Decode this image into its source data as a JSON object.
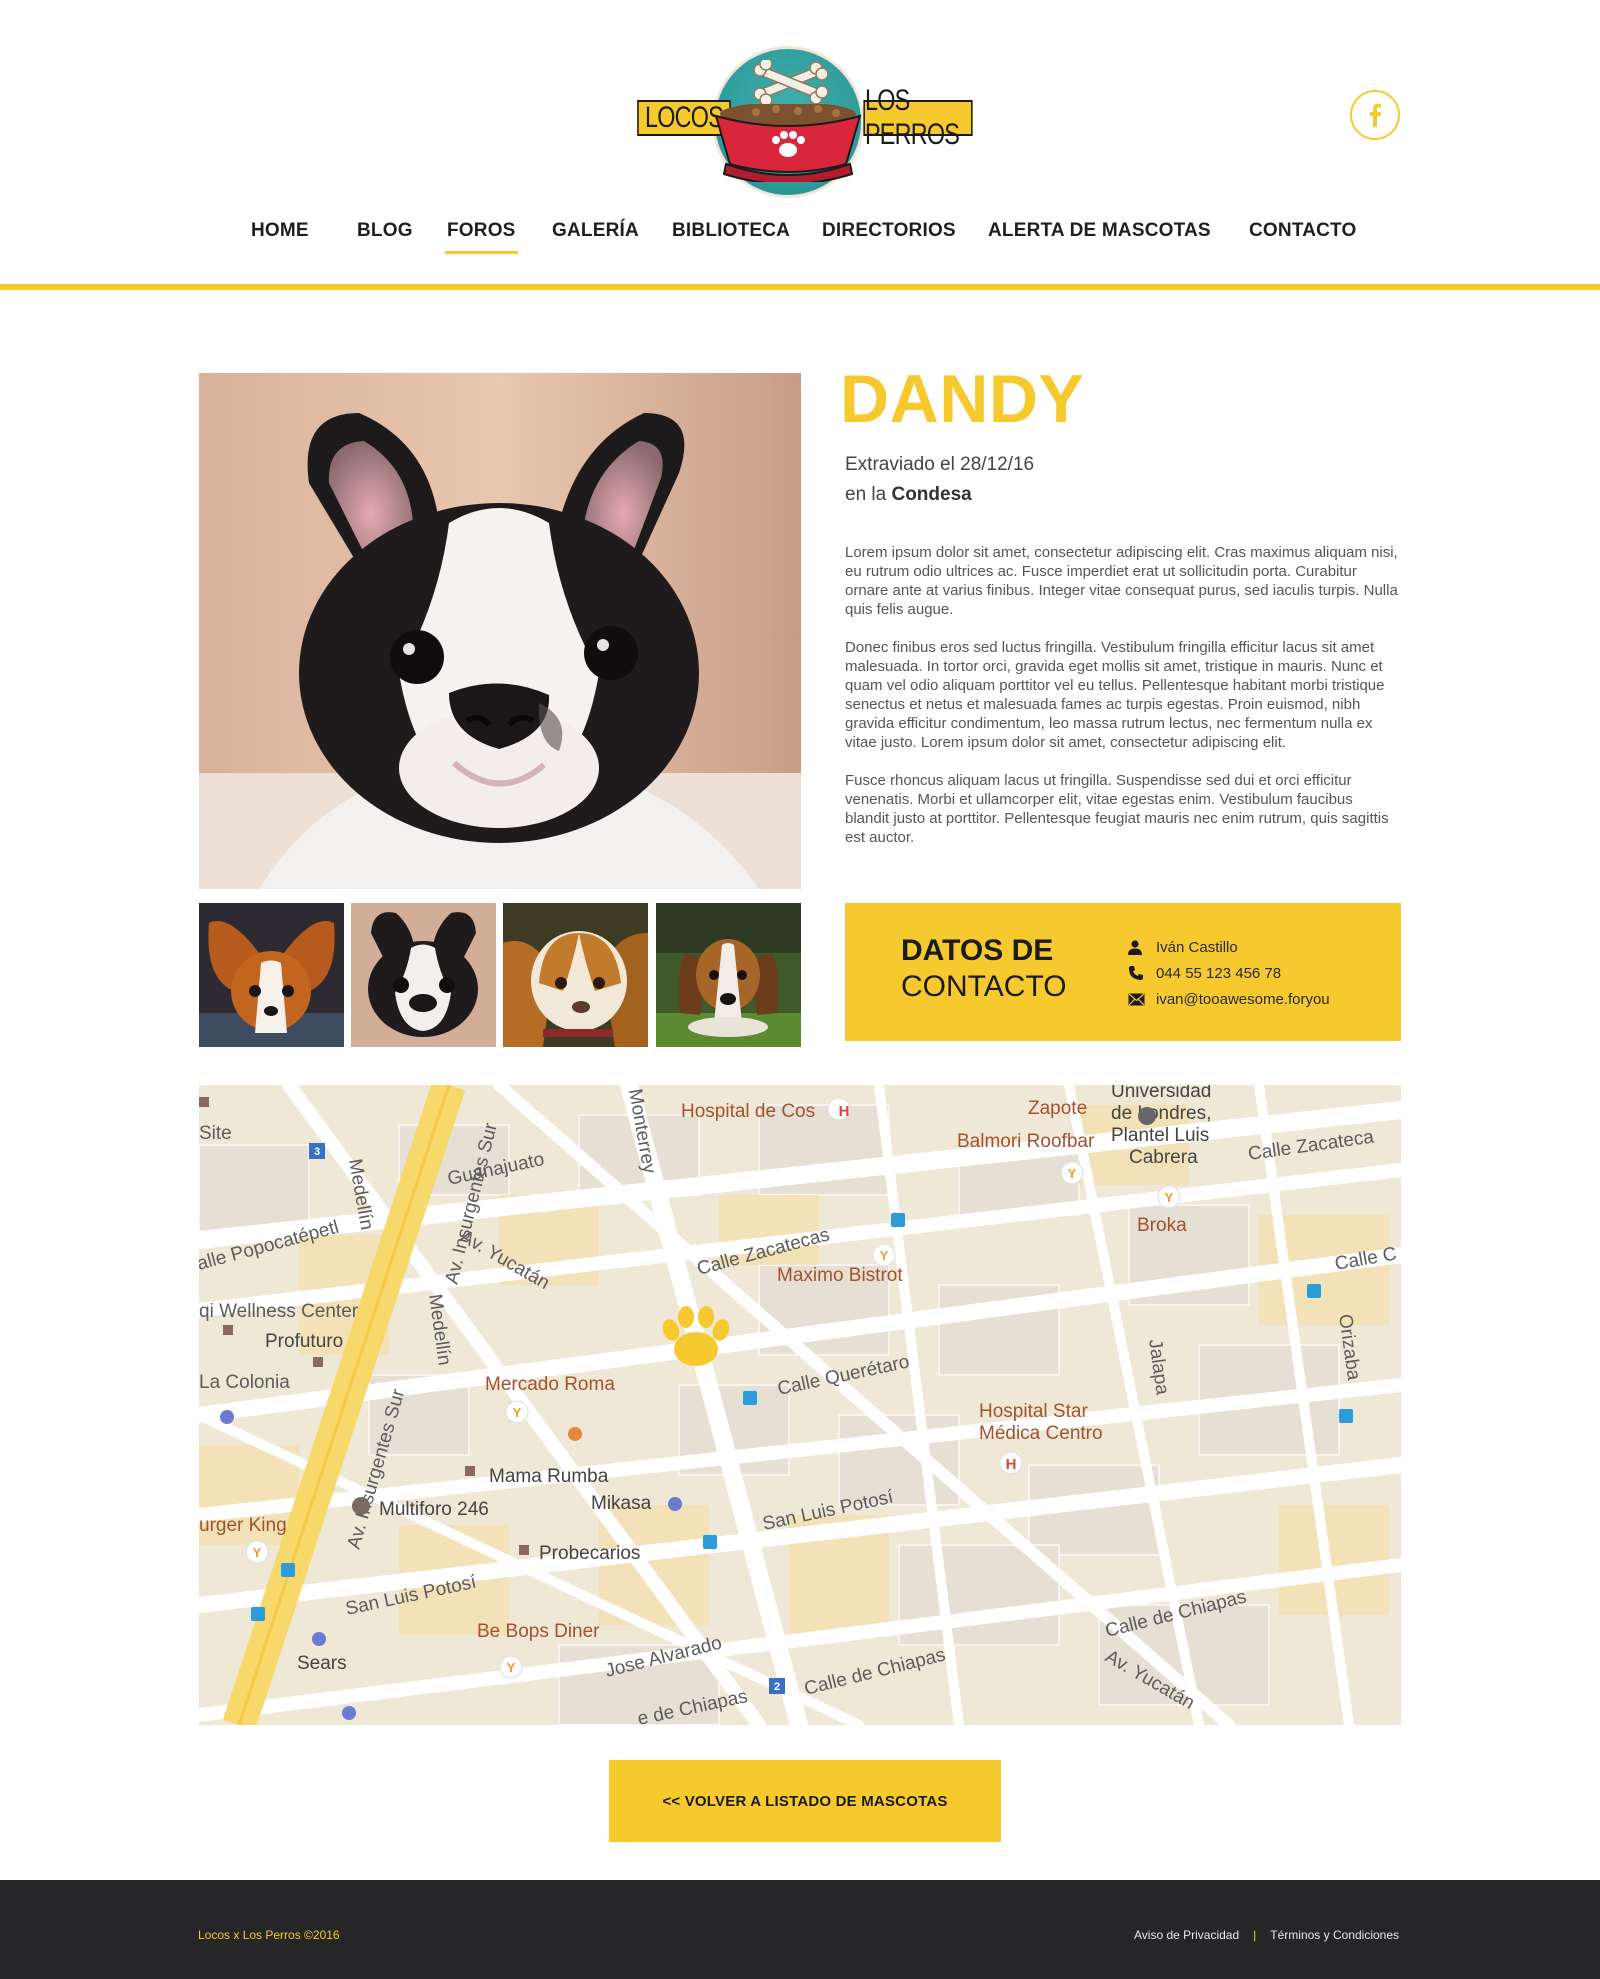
{
  "brand": {
    "logo_left": "LOCOS",
    "logo_right": "LOS PERROS",
    "primary_color": "#f6c92e",
    "dark_color": "#262528"
  },
  "social": {
    "icon": "facebook-icon"
  },
  "nav": {
    "items": [
      {
        "label": "HOME"
      },
      {
        "label": "BLOG"
      },
      {
        "label": "FOROS"
      },
      {
        "label": "GALERÍA"
      },
      {
        "label": "BIBLIOTECA"
      },
      {
        "label": "DIRECTORIOS"
      },
      {
        "label": "ALERTA DE MASCOTAS"
      },
      {
        "label": "CONTACTO"
      }
    ],
    "active": "FOROS"
  },
  "pet": {
    "name": "DANDY",
    "lost_prefix": "Extraviado el",
    "lost_date": "28/12/16",
    "location_prefix": "en la",
    "location": "Condesa",
    "paragraphs": [
      " Lorem ipsum dolor sit amet, consectetur adipiscing elit. Cras maximus aliquam nisi, eu rutrum odio ultrices ac. Fusce imperdiet erat ut sollicitudin porta. Curabitur ornare ante at varius finibus. Integer vitae consequat purus, sed iaculis turpis. Nulla quis felis augue.",
      "Donec finibus eros sed luctus fringilla. Vestibulum fringilla efficitur lacus sit amet malesuada. In tortor orci, gravida eget mollis sit amet, tristique in mauris. Nunc et quam vel odio aliquam porttitor vel eu tellus. Pellentesque habitant morbi tristique senectus et netus et malesuada fames ac turpis egestas. Proin euismod, nibh gravida efficitur condimentum, leo massa rutrum lectus, nec fermentum nulla ex vitae justo. Lorem ipsum dolor sit amet, consectetur adipiscing elit.",
      "Fusce rhoncus aliquam lacus ut fringilla. Suspendisse sed dui et orci efficitur venenatis. Morbi et ullamcorper elit, vitae egestas enim. Vestibulum faucibus blandit justo at porttitor. Pellentesque feugiat mauris nec enim rutrum, quis sagittis est auctor."
    ]
  },
  "contact": {
    "title_bold": "DATOS DE",
    "title_light": "CONTACTO",
    "name": "Iván Castillo",
    "phone": "044 55 123 456 78",
    "email": "ivan@tooawesome.foryou"
  },
  "map": {
    "marker_icon": "paw-icon",
    "labels": {
      "hospital_cos": "Hospital de Cos",
      "zapote": "Zapote",
      "universidad_1": "Universidad",
      "universidad_2": "de Londres,",
      "universidad_3": "Plantel Luis",
      "universidad_4": "Cabrera",
      "balmori": "Balmori Roofbar",
      "calle_zacatecas_ne": "Calle Zacateca",
      "site": "Site",
      "medellin_top": "Medellín",
      "guanajuato": "Guanajuato",
      "monterrey": "Monterrey",
      "broka": "Broka",
      "calle_popocatepetl": "alle Popocatépetl",
      "av_insurgentes_1": "Av. Insurgentes Sur",
      "av_yucatan_1": "Av. Yucatán",
      "calle_zacatecas": "Calle Zacatecas",
      "maximo": "Maximo Bistrot",
      "calle_c": "Calle C",
      "wellness": "qi Wellness Center",
      "profuturo": "Profuturo",
      "medellin_mid": "Medellín",
      "orizaba": "Orizaba",
      "la_colonia": "La Colonia",
      "mercado_roma": "Mercado Roma",
      "calle_queretaro": "Calle Querétaro",
      "jalapa": "Jalapa",
      "hospital_star_1": "Hospital Star",
      "hospital_star_2": "Médica Centro",
      "av_insurgentes_2": "Av. Insurgentes Sur",
      "mama_rumba": "Mama Rumba",
      "mikasa": "Mikasa",
      "multiforo": "Multiforo 246",
      "san_luis_1": "San Luis Potosí",
      "burger_king": "urger King",
      "probecarios": "Probecarios",
      "san_luis_2": "San Luis Potosí",
      "calle_chiapas_1": "Calle de Chiapas",
      "be_bops": "Be Bops Diner",
      "sears": "Sears",
      "jose_alvarado": "Jose Alvarado",
      "av_yucatan_2": "Av. Yucatán",
      "calle_chiapas_2": "Calle de Chiapas",
      "de_chiapas": "e de Chiapas",
      "metro_3": "3",
      "metro_2": "2"
    }
  },
  "back_button": "<< VOLVER A LISTADO DE MASCOTAS",
  "footer": {
    "copyright": "Locos x Los Perros ©2016",
    "privacy": "Aviso de Privacidad",
    "separator": "|",
    "terms": "Términos y Condiciones"
  }
}
